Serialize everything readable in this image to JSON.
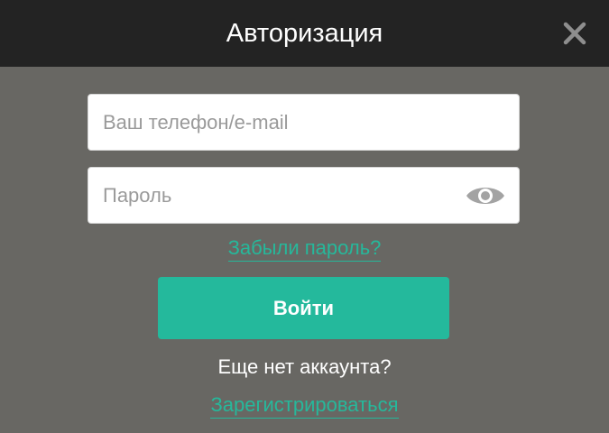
{
  "modal": {
    "title": "Авторизация",
    "close_icon": "close-icon"
  },
  "form": {
    "phone_placeholder": "Ваш телефон/e-mail",
    "phone_value": "",
    "password_placeholder": "Пароль",
    "password_value": "",
    "show_password_icon": "eye-icon",
    "forgot_password_link": "Забыли пароль?",
    "login_button": "Войти"
  },
  "footer": {
    "no_account_text": "Еще нет аккаунта?",
    "register_link": "Зарегистрироваться"
  },
  "colors": {
    "header_bg": "#232323",
    "modal_bg": "#686763",
    "accent": "#24b99c"
  }
}
